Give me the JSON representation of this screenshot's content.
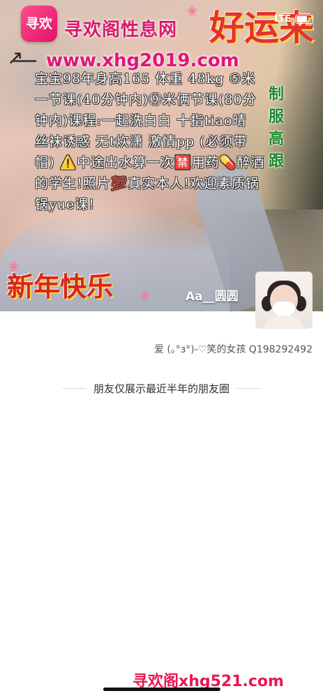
{
  "cover": {
    "logo_text": "寻欢",
    "site_title": "寻欢阁性息网",
    "blessing": "好运来",
    "url": "www.xhg2019.com",
    "ad_text": "宝宝98年身高165 体重 48kg ⑤米一节课(40分钟内)⑨米俩节课(80分钟内)课程:一起洗白白 十指tiao晴 丝袜诱惑 无t炊潇 激情pp (必须带帽) ⚠️中途出水算一次🈲用药💊醉酒的学生!照片💯真实本人!欢迎素质锅锅yue课!",
    "side_text": "制服高跟",
    "new_year": "新年快乐"
  },
  "status_bar": {
    "network": "LTE"
  },
  "profile": {
    "nickname": "Aa__圆圆",
    "signature": "爱 (｡°з°)-♡笑的女孩 Q198292492"
  },
  "feed": {
    "notice": "朋友仅展示最近半年的朋友圈"
  },
  "watermark": "寻欢阁xhg521.com"
}
